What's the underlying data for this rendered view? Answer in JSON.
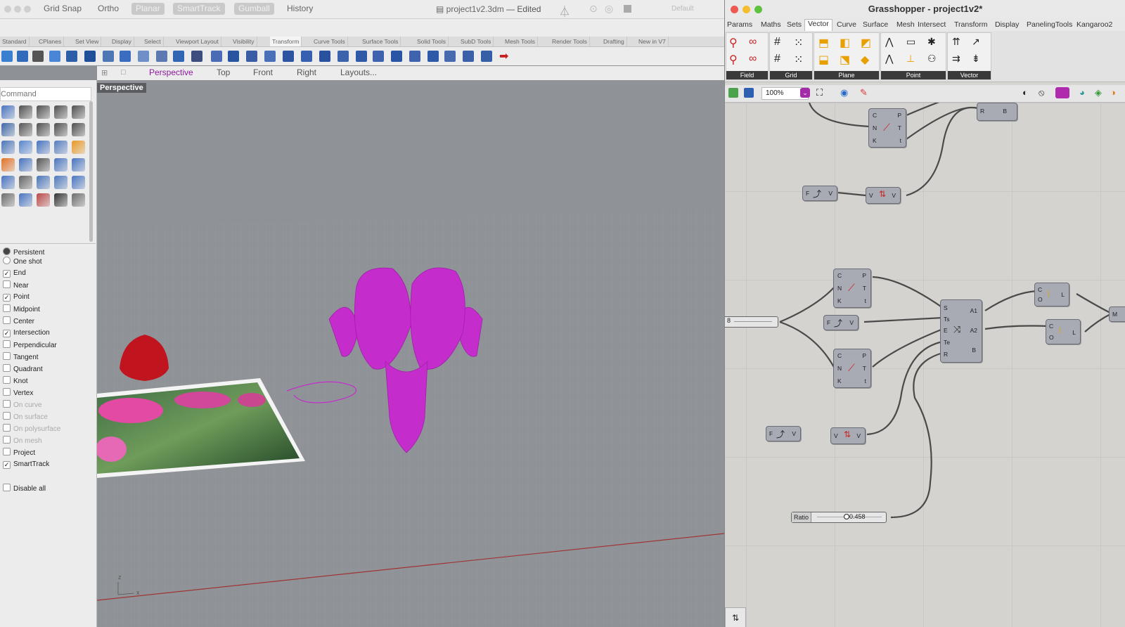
{
  "rhino": {
    "document_title": "project1v2.3dm",
    "edited_label": "— Edited",
    "toggles": [
      {
        "label": "Grid Snap",
        "state": "on"
      },
      {
        "label": "Ortho",
        "state": "on"
      },
      {
        "label": "Planar",
        "state": "off"
      },
      {
        "label": "SmartTrack",
        "state": "off"
      },
      {
        "label": "Gumball",
        "state": "off"
      },
      {
        "label": "History",
        "state": "on"
      }
    ],
    "display_mode": "Default",
    "toolbar_tabs": [
      "Standard",
      "CPlanes",
      "Set View",
      "Display",
      "Select",
      "Viewport Layout",
      "Visibility",
      "Transform",
      "Curve Tools",
      "Surface Tools",
      "Solid Tools",
      "SubD Tools",
      "Mesh Tools",
      "Render Tools",
      "Drafting",
      "New in V7"
    ],
    "view_tabs": [
      "Perspective",
      "Top",
      "Front",
      "Right",
      "Layouts..."
    ],
    "active_view": "Perspective",
    "command_placeholder": "Command",
    "osnap_mode": [
      {
        "label": "Persistent",
        "checked": true
      },
      {
        "label": "One shot",
        "checked": false
      }
    ],
    "osnaps": [
      {
        "label": "End",
        "checked": true,
        "enabled": true
      },
      {
        "label": "Near",
        "checked": false,
        "enabled": true
      },
      {
        "label": "Point",
        "checked": true,
        "enabled": true
      },
      {
        "label": "Midpoint",
        "checked": false,
        "enabled": true
      },
      {
        "label": "Center",
        "checked": false,
        "enabled": true
      },
      {
        "label": "Intersection",
        "checked": true,
        "enabled": true
      },
      {
        "label": "Perpendicular",
        "checked": false,
        "enabled": true
      },
      {
        "label": "Tangent",
        "checked": false,
        "enabled": true
      },
      {
        "label": "Quadrant",
        "checked": false,
        "enabled": true
      },
      {
        "label": "Knot",
        "checked": false,
        "enabled": true
      },
      {
        "label": "Vertex",
        "checked": false,
        "enabled": true
      },
      {
        "label": "On curve",
        "checked": false,
        "enabled": false
      },
      {
        "label": "On surface",
        "checked": false,
        "enabled": false
      },
      {
        "label": "On polysurface",
        "checked": false,
        "enabled": false
      },
      {
        "label": "On mesh",
        "checked": false,
        "enabled": false
      },
      {
        "label": "Project",
        "checked": false,
        "enabled": true
      },
      {
        "label": "SmartTrack",
        "checked": true,
        "enabled": true
      }
    ],
    "disable_all": "Disable all",
    "viewport_label": "Perspective",
    "axis_x": "x",
    "axis_z": "z"
  },
  "grasshopper": {
    "title": "Grasshopper - project1v2*",
    "menu": [
      "Params",
      "Maths",
      "Sets",
      "Vector",
      "Curve",
      "Surface",
      "Mesh",
      "Intersect",
      "Transform",
      "Display",
      "PanelingTools",
      "Kangaroo2"
    ],
    "active_menu": "Vector",
    "ribbon_groups": [
      "Field",
      "Grid",
      "Plane",
      "Point",
      "Vector"
    ],
    "zoom": "100%",
    "slider_label": "Ratio",
    "slider_value": "0.458",
    "slider_value2": "8",
    "colors": {
      "accent": "#c42dcc",
      "node": "#a9abb4"
    }
  }
}
